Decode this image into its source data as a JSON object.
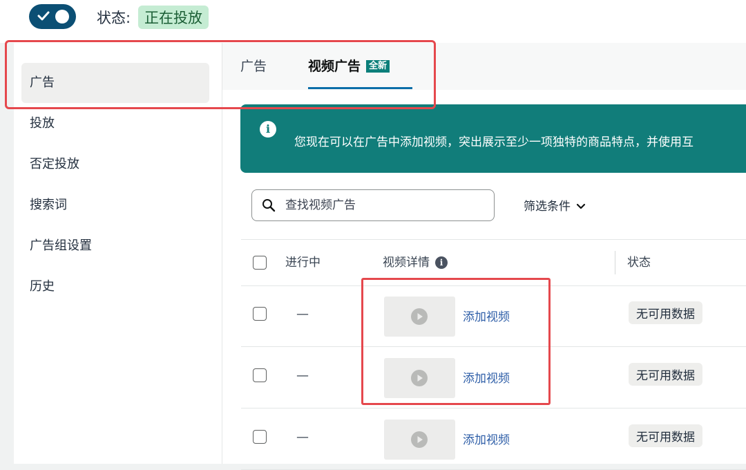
{
  "status": {
    "label": "状态:",
    "value": "正在投放",
    "enabled": true
  },
  "sidebar": {
    "items": [
      {
        "label": "广告",
        "active": true
      },
      {
        "label": "投放"
      },
      {
        "label": "否定投放"
      },
      {
        "label": "搜索词"
      },
      {
        "label": "广告组设置"
      },
      {
        "label": "历史"
      }
    ]
  },
  "tabs": [
    {
      "label": "广告"
    },
    {
      "label": "视频广告",
      "badge": "全新",
      "active": true
    }
  ],
  "banner": {
    "icon": "info-icon",
    "text": "您现在可以在广告中添加视频，突出展示至少一项独特的商品特点，并使用互"
  },
  "search": {
    "placeholder": "查找视频广告",
    "value": ""
  },
  "filter": {
    "label": "筛选条件"
  },
  "table": {
    "headers": {
      "active": "进行中",
      "video_details": "视频详情",
      "status": "状态"
    },
    "rows": [
      {
        "active": "—",
        "action": "添加视频",
        "status": "无可用数据"
      },
      {
        "active": "—",
        "action": "添加视频",
        "status": "无可用数据"
      },
      {
        "active": "—",
        "action": "添加视频",
        "status": "无可用数据"
      }
    ]
  },
  "colors": {
    "toggle": "#0b4f74",
    "banner": "#117d7a",
    "link": "#2f5fa8",
    "annotation": "#e5484d",
    "status_badge": "#c5ecd3"
  }
}
